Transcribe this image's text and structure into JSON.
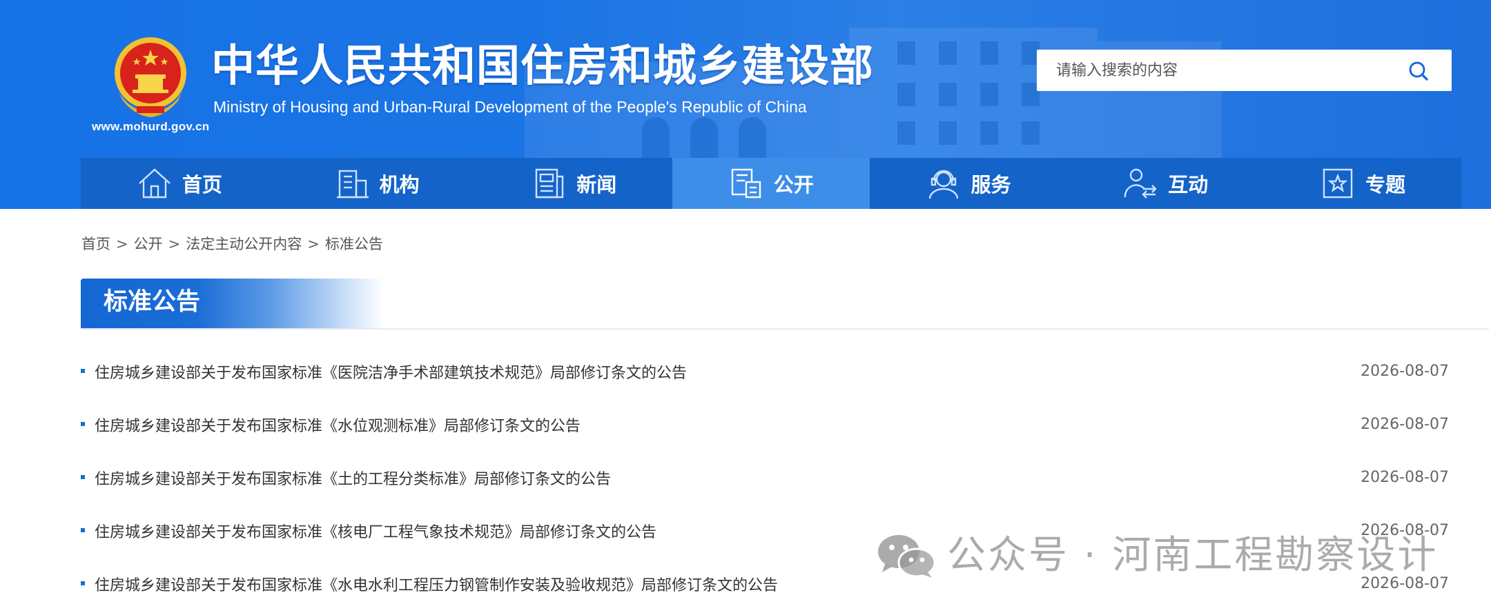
{
  "header": {
    "title_cn": "中华人民共和国住房和城乡建设部",
    "title_en": "Ministry of Housing and Urban-Rural Development of the People's Republic of China",
    "domain": "www.mohurd.gov.cn",
    "search": {
      "placeholder": "请输入搜索的内容"
    }
  },
  "nav": [
    {
      "label": "首页",
      "icon": "home-icon",
      "active": false
    },
    {
      "label": "机构",
      "icon": "building-icon",
      "active": false
    },
    {
      "label": "新闻",
      "icon": "newspaper-icon",
      "active": false
    },
    {
      "label": "公开",
      "icon": "document-icon",
      "active": true
    },
    {
      "label": "服务",
      "icon": "service-icon",
      "active": false
    },
    {
      "label": "互动",
      "icon": "interaction-icon",
      "active": false
    },
    {
      "label": "专题",
      "icon": "star-icon",
      "active": false
    }
  ],
  "breadcrumb": [
    "首页",
    "公开",
    "法定主动公开内容",
    "标准公告"
  ],
  "breadcrumb_sep": ">",
  "section": {
    "title": "标准公告"
  },
  "notices": [
    {
      "title": "住房城乡建设部关于发布国家标准《医院洁净手术部建筑技术规范》局部修订条文的公告",
      "date": "2026-08-07"
    },
    {
      "title": "住房城乡建设部关于发布国家标准《水位观测标准》局部修订条文的公告",
      "date": "2026-08-07"
    },
    {
      "title": "住房城乡建设部关于发布国家标准《土的工程分类标准》局部修订条文的公告",
      "date": "2026-08-07"
    },
    {
      "title": "住房城乡建设部关于发布国家标准《核电厂工程气象技术规范》局部修订条文的公告",
      "date": "2026-08-07"
    },
    {
      "title": "住房城乡建设部关于发布国家标准《水电水利工程压力钢管制作安装及验收规范》局部修订条文的公告",
      "date": "2026-08-07"
    }
  ],
  "watermark": {
    "text": "公众号 · 河南工程勘察设计",
    "icon": "wechat-icon"
  },
  "colors": {
    "header_blue": "#1b74e4",
    "nav_blue": "#1463c9",
    "nav_active": "#3d8ee8",
    "bullet": "#1a6cd6"
  }
}
